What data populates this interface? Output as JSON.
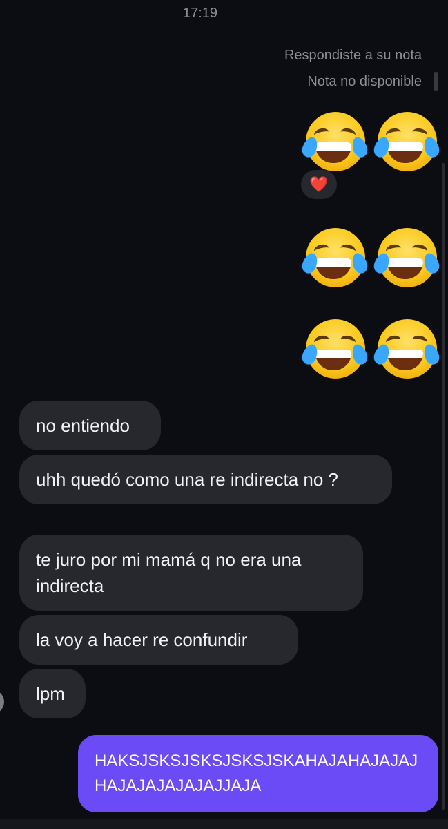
{
  "header": {
    "time": "17:19"
  },
  "reply": {
    "line1": "Respondiste a su nota",
    "line2": "Nota no disponible"
  },
  "reaction": {
    "emoji": "❤️",
    "icon": "heart-icon"
  },
  "emoji_messages": [
    {
      "icon": "tears-of-joy-emoji",
      "count": 2
    },
    {
      "icon": "tears-of-joy-emoji",
      "count": 2
    },
    {
      "icon": "tears-of-joy-emoji",
      "count": 2
    }
  ],
  "messages_in": [
    {
      "text": "no entiendo"
    },
    {
      "text": "uhh quedó como una re indirecta no ?"
    },
    {
      "text": "te juro por mi mamá q no era una indirecta"
    },
    {
      "text": "la voy a hacer re confundir"
    },
    {
      "text": "lpm"
    }
  ],
  "message_out": {
    "text": "HAKSJSKSJSKSJSKSJSKAHAJAHAJAJAJHAJAJAJAJAJAJJAJA"
  },
  "colors": {
    "background": "#0b0d12",
    "incoming_bubble": "#26282e",
    "outgoing_bubble": "#6a4bf5",
    "muted_text": "#8e8e93"
  }
}
